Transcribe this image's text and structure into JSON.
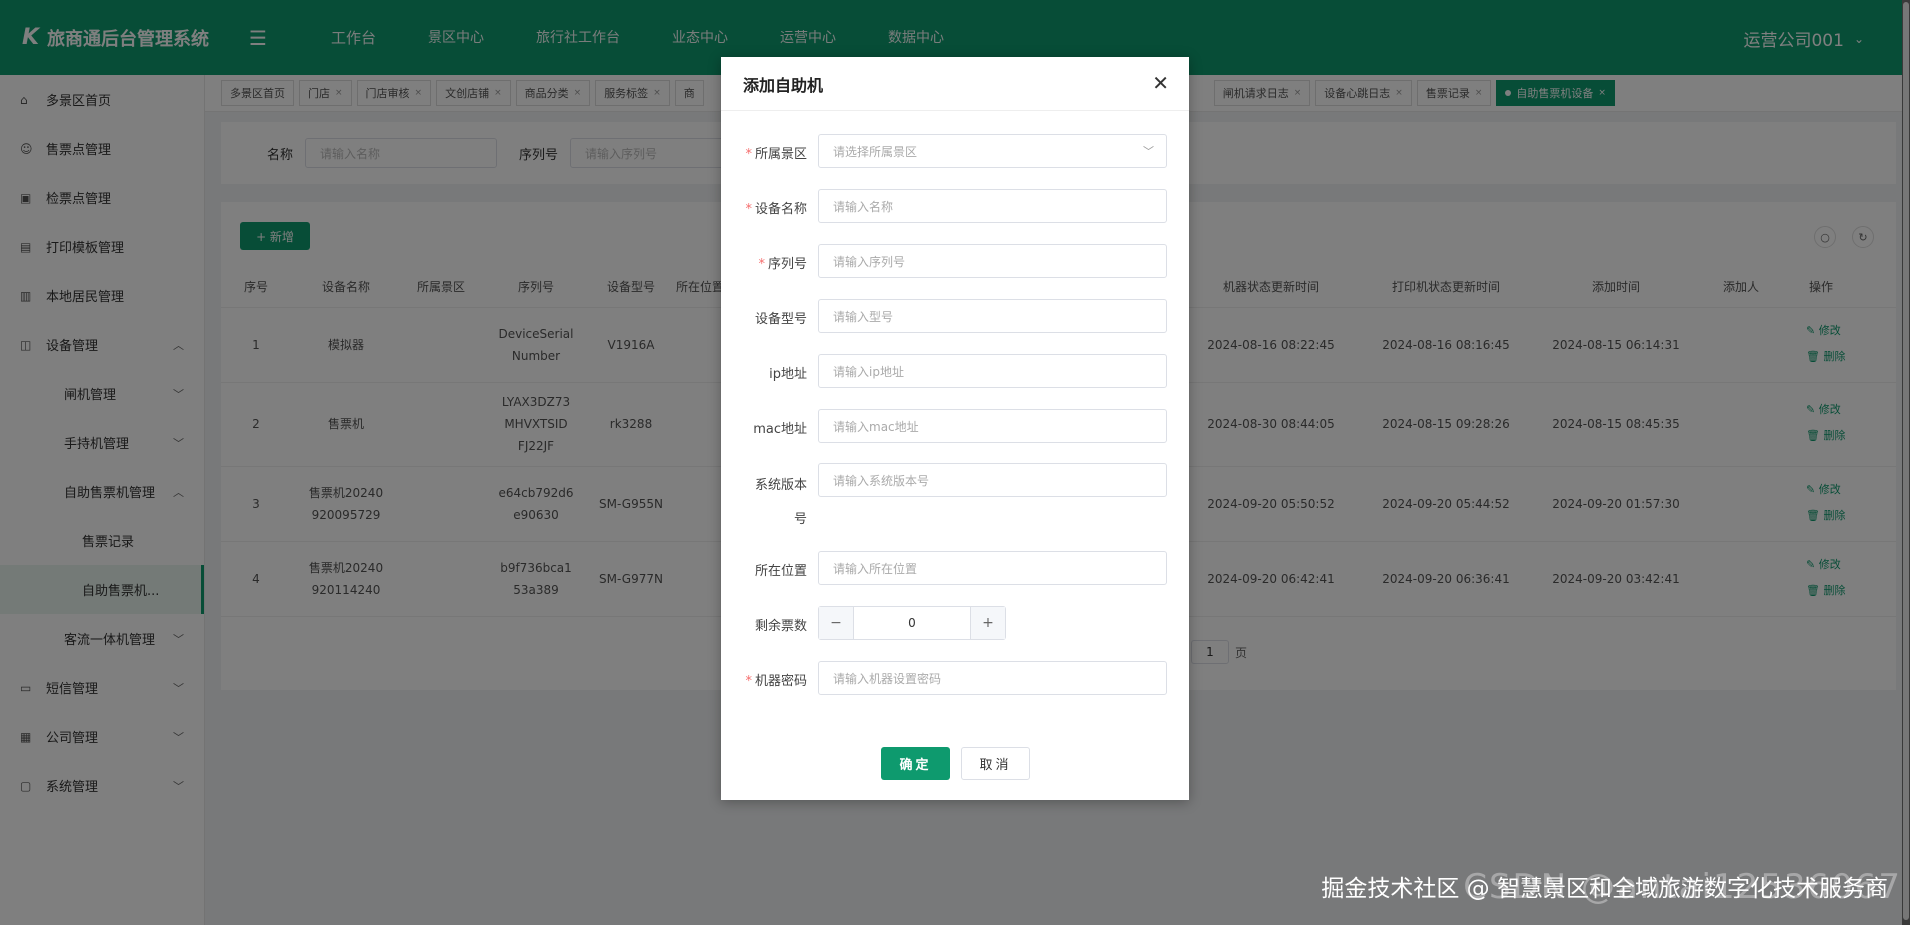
{
  "header": {
    "logo_mark": "K",
    "title": "旅商通后台管理系统",
    "nav": [
      "工作台",
      "景区中心",
      "旅行社工作台",
      "业态中心",
      "运营中心",
      "数据中心"
    ],
    "user": "运营公司001"
  },
  "sidebar": {
    "items": [
      {
        "label": "多景区首页",
        "icon": "home-icon"
      },
      {
        "label": "售票点管理",
        "icon": "user-icon"
      },
      {
        "label": "检票点管理",
        "icon": "ticket-icon"
      },
      {
        "label": "打印模板管理",
        "icon": "print-icon"
      },
      {
        "label": "本地居民管理",
        "icon": "id-card-icon"
      },
      {
        "label": "设备管理",
        "icon": "device-icon"
      },
      {
        "label": "闸机管理"
      },
      {
        "label": "手持机管理"
      },
      {
        "label": "自助售票机管理"
      },
      {
        "label": "售票记录"
      },
      {
        "label": "自助售票机..."
      },
      {
        "label": "客流一体机管理"
      },
      {
        "label": "短信管理",
        "icon": "message-icon"
      },
      {
        "label": "公司管理",
        "icon": "building-icon"
      },
      {
        "label": "系统管理",
        "icon": "settings-icon"
      }
    ]
  },
  "tabs": [
    "多景区首页",
    "门店",
    "门店审核",
    "文创店铺",
    "商品分类",
    "服务标签",
    "商",
    "闸机请求日志",
    "设备心跳日志",
    "售票记录",
    "自助售票机设备"
  ],
  "search": {
    "name_label": "名称",
    "name_placeholder": "请输入名称",
    "serial_label": "序列号",
    "serial_placeholder": "请输入序列号"
  },
  "table": {
    "add_label": "+ 新增",
    "columns": [
      "序号",
      "设备名称",
      "所属景区",
      "序列号",
      "设备型号",
      "所在位置",
      "机器状态更新时间",
      "打印机状态更新时间",
      "添加时间",
      "添加人",
      "操作"
    ],
    "rows": [
      {
        "no": "1",
        "name": [
          "模拟器"
        ],
        "serial": [
          "DeviceSerial",
          "Number"
        ],
        "model": "V1916A",
        "machine_time": "2024-08-16 08:22:45",
        "printer_time": "2024-08-16 08:16:45",
        "added": "2024-08-15 06:14:31"
      },
      {
        "no": "2",
        "name": [
          "售票机"
        ],
        "serial": [
          "LYAX3DZ73",
          "MHVXTSID",
          "FJ22JF"
        ],
        "model": "rk3288",
        "machine_time": "2024-08-30 08:44:05",
        "printer_time": "2024-08-15 09:28:26",
        "added": "2024-08-15 08:45:35"
      },
      {
        "no": "3",
        "name": [
          "售票机20240",
          "920095729"
        ],
        "serial": [
          "e64cb792d6",
          "e90630"
        ],
        "model": "SM-G955N",
        "machine_time": "2024-09-20 05:50:52",
        "printer_time": "2024-09-20 05:44:52",
        "added": "2024-09-20 01:57:30"
      },
      {
        "no": "4",
        "name": [
          "售票机20240",
          "920114240"
        ],
        "serial": [
          "b9f736bca1",
          "53a389"
        ],
        "model": "SM-G977N",
        "machine_time": "2024-09-20 06:42:41",
        "printer_time": "2024-09-20 06:36:41",
        "added": "2024-09-20 03:42:41"
      }
    ],
    "edit_label": "✎ 修改",
    "delete_label": "🗑 删除",
    "page_number": "1",
    "page_suffix": "页"
  },
  "dialog": {
    "title": "添加自助机",
    "fields": [
      {
        "label": "所属景区",
        "placeholder": "请选择所属景区",
        "required": true
      },
      {
        "label": "设备名称",
        "placeholder": "请输入名称",
        "required": true
      },
      {
        "label": "序列号",
        "placeholder": "请输入序列号",
        "required": true
      },
      {
        "label": "设备型号",
        "placeholder": "请输入型号",
        "required": false
      },
      {
        "label": "ip地址",
        "placeholder": "请输入ip地址",
        "required": false
      },
      {
        "label": "mac地址",
        "placeholder": "请输入mac地址",
        "required": false
      },
      {
        "label": "系统版本号",
        "placeholder": "请输入系统版本号",
        "required": false
      },
      {
        "label": "所在位置",
        "placeholder": "请输入所在位置",
        "required": false
      },
      {
        "label": "剩余票数",
        "value": "0",
        "required": false
      },
      {
        "label": "机器密码",
        "placeholder": "请输入机器设置密码",
        "required": true
      }
    ],
    "ok_label": "确定",
    "cancel_label": "取消"
  },
  "watermark": "掘金技术社区 @ 智慧景区和全域旅游数字化技术服务商",
  "watermark_bg": "CSDN @antai12536067"
}
